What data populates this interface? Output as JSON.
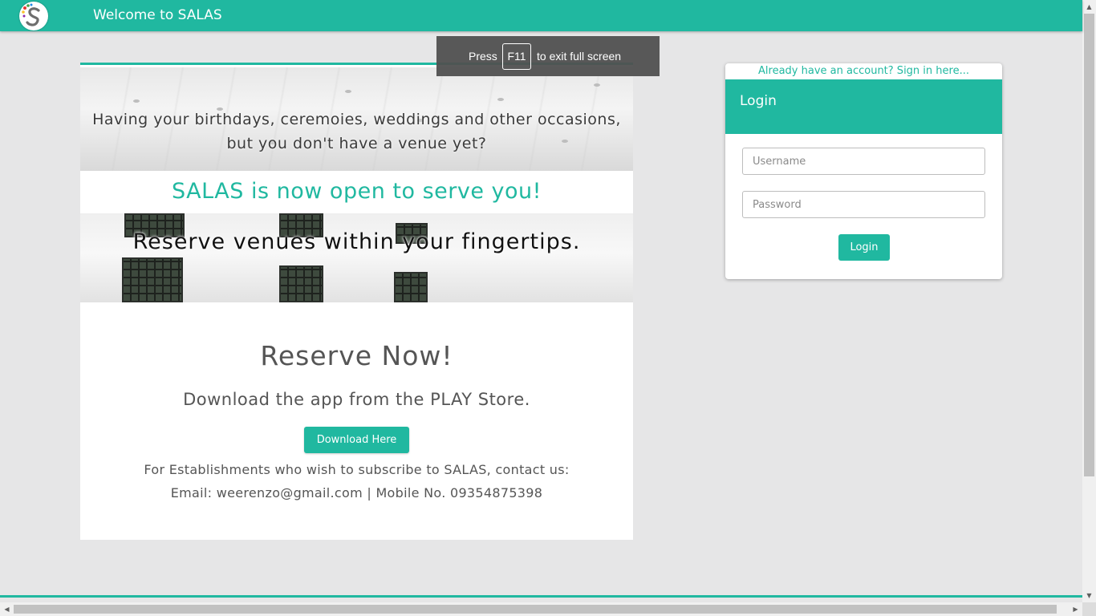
{
  "navbar": {
    "title": "Welcome to SALAS",
    "logo_icon": "salas-logo-icon",
    "background": "#20b8a0"
  },
  "fullscreen_toast": {
    "press": "Press",
    "key": "F11",
    "message": "to exit full screen"
  },
  "hero": {
    "banner_question": "Having your birthdays, ceremoies, weddings and other occasions, but you don't have a venue yet?",
    "headline": "SALAS is now open to serve you!",
    "tagline": "Reserve venues within your fingertips.",
    "reserve_title": "Reserve Now!",
    "download_subtitle": "Download the app from the PLAY Store.",
    "download_button": "Download Here",
    "contact_intro": "For Establishments who wish to subscribe to SALAS, contact us:",
    "contact_details": "Email: weerenzo@gmail.com | Mobile No. 09354875398"
  },
  "login": {
    "signin_link": "Already have an account? Sign in here...",
    "header_title": "Login",
    "username_placeholder": "Username",
    "password_placeholder": "Password",
    "submit_label": "Login"
  },
  "theme": {
    "accent": "#20b8a0",
    "page_background": "#e6e6e7"
  }
}
